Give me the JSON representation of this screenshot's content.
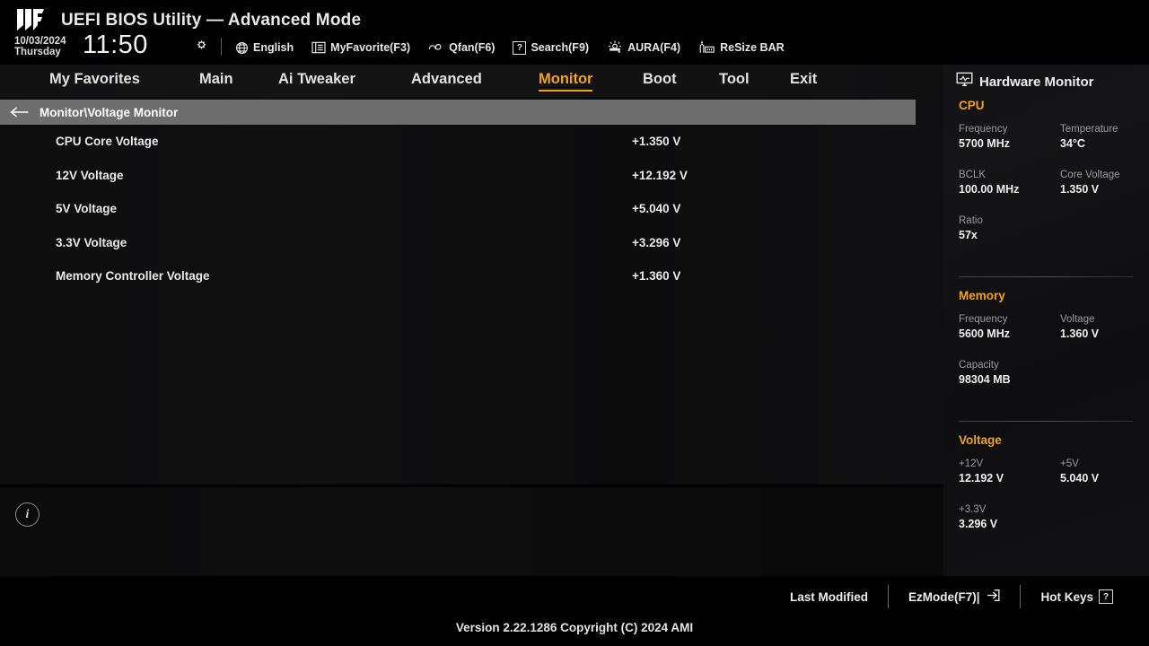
{
  "header": {
    "logo_icon": "tuf-gaming-logo",
    "title": "UEFI BIOS Utility — Advanced Mode",
    "date": "10/03/2024",
    "weekday": "Thursday",
    "time": "11:50",
    "gear_icon": "gear-icon",
    "items": [
      {
        "icon": "globe-icon",
        "label": "English"
      },
      {
        "icon": "list-icon",
        "label": "MyFavorite(F3)"
      },
      {
        "icon": "fan-icon",
        "label": "Qfan(F6)"
      },
      {
        "icon": "question-icon",
        "label": "Search(F9)"
      },
      {
        "icon": "aura-icon",
        "label": "AURA(F4)"
      },
      {
        "icon": "resize-bar-icon",
        "label": "ReSize BAR"
      }
    ]
  },
  "menu": {
    "items": [
      {
        "label": "My Favorites",
        "active": false
      },
      {
        "label": "Main",
        "active": false
      },
      {
        "label": "Ai Tweaker",
        "active": false
      },
      {
        "label": "Advanced",
        "active": false
      },
      {
        "label": "Monitor",
        "active": true
      },
      {
        "label": "Boot",
        "active": false
      },
      {
        "label": "Tool",
        "active": false
      },
      {
        "label": "Exit",
        "active": false
      }
    ],
    "accent_color": "#f0a31b"
  },
  "breadcrumb": {
    "back_icon": "arrow-left-icon",
    "path": "Monitor\\Voltage Monitor"
  },
  "main": {
    "rows": [
      {
        "label": "CPU Core Voltage",
        "value": "+1.350 V"
      },
      {
        "label": "12V Voltage",
        "value": "+12.192 V"
      },
      {
        "label": "5V Voltage",
        "value": "+5.040 V"
      },
      {
        "label": "3.3V Voltage",
        "value": "+3.296 V"
      },
      {
        "label": "Memory Controller Voltage",
        "value": "+1.360 V"
      }
    ],
    "info_icon": "info-icon",
    "info_glyph": "i"
  },
  "sidebar": {
    "icon": "monitor-waveform-icon",
    "title": "Hardware Monitor",
    "sections": [
      {
        "name": "CPU",
        "pairs": [
          {
            "key": "Frequency",
            "value": "5700 MHz"
          },
          {
            "key": "Temperature",
            "value": "34°C"
          },
          {
            "key": "BCLK",
            "value": "100.00 MHz"
          },
          {
            "key": "Core Voltage",
            "value": "1.350 V"
          },
          {
            "key": "Ratio",
            "value": "57x"
          }
        ]
      },
      {
        "name": "Memory",
        "pairs": [
          {
            "key": "Frequency",
            "value": "5600 MHz"
          },
          {
            "key": "Voltage",
            "value": "1.360 V"
          },
          {
            "key": "Capacity",
            "value": "98304 MB"
          }
        ]
      },
      {
        "name": "Voltage",
        "pairs": [
          {
            "key": "+12V",
            "value": "12.192 V"
          },
          {
            "key": "+5V",
            "value": "5.040 V"
          },
          {
            "key": "+3.3V",
            "value": "3.296 V"
          }
        ]
      }
    ]
  },
  "bottom": {
    "last_modified": "Last Modified",
    "ezmode": "EzMode(F7)|",
    "ezmode_icon": "exit-arrow-icon",
    "hotkeys": "Hot Keys",
    "hotkeys_glyph": "?",
    "version": "Version 2.22.1286 Copyright (C) 2024 AMI"
  }
}
